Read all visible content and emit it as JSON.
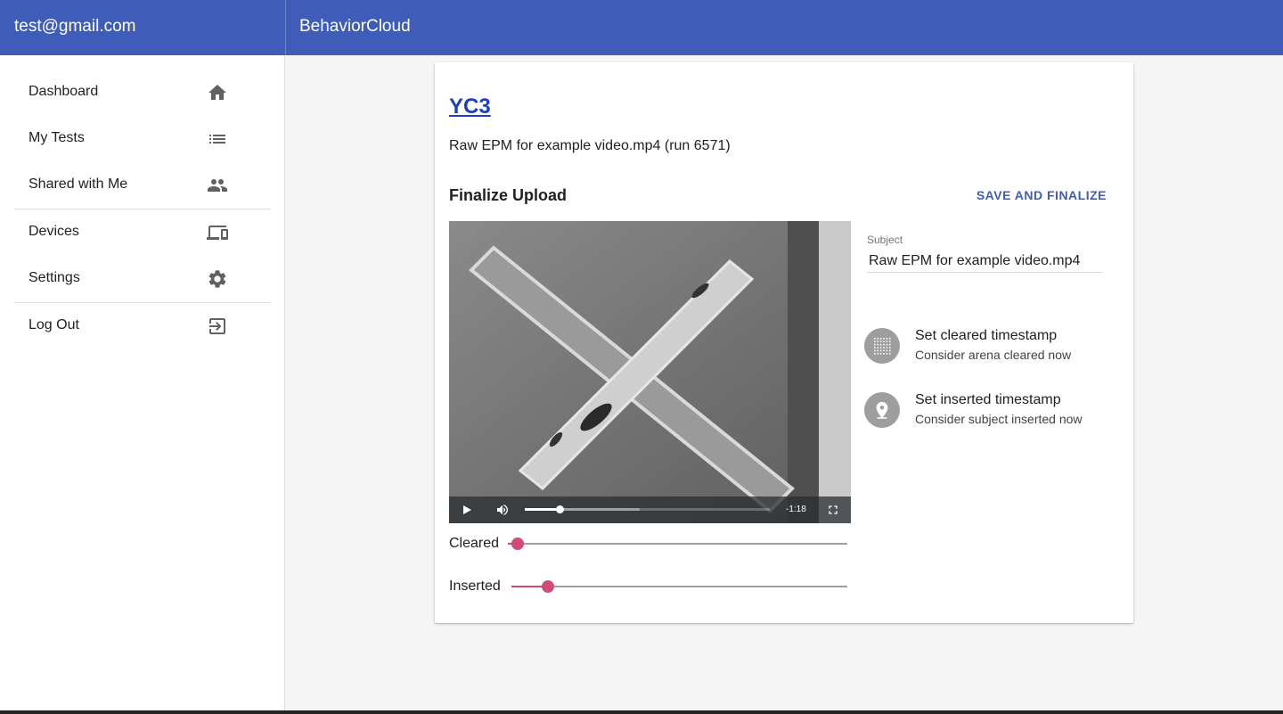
{
  "appbar": {
    "user_email": "test@gmail.com",
    "app_title": "BehaviorCloud"
  },
  "sidebar": {
    "items": [
      {
        "label": "Dashboard",
        "icon": "home-icon"
      },
      {
        "label": "My Tests",
        "icon": "list-icon"
      },
      {
        "label": "Shared with Me",
        "icon": "people-icon"
      },
      {
        "label": "Devices",
        "icon": "devices-icon"
      },
      {
        "label": "Settings",
        "icon": "gear-icon"
      },
      {
        "label": "Log Out",
        "icon": "exit-icon"
      }
    ]
  },
  "card": {
    "title": "YC3",
    "subtitle": "Raw EPM for example video.mp4 (run 6571)",
    "section_title": "Finalize Upload",
    "save_label": "SAVE AND FINALIZE"
  },
  "video": {
    "time_remaining": "-1:18",
    "played_fraction": 0.14,
    "buffered_fraction": 0.47
  },
  "sliders": [
    {
      "label": "Cleared",
      "value_fraction": 0.03
    },
    {
      "label": "Inserted",
      "value_fraction": 0.11
    }
  ],
  "subject": {
    "label": "Subject",
    "value": "Raw EPM for example video.mp4"
  },
  "actions": [
    {
      "primary": "Set cleared timestamp",
      "secondary": "Consider arena cleared now",
      "icon": "grid-dots-icon"
    },
    {
      "primary": "Set inserted timestamp",
      "secondary": "Consider subject inserted now",
      "icon": "location-pin-icon"
    }
  ],
  "colors": {
    "primary": "#3f5db8",
    "accent": "#d14b78",
    "link": "#1a3fbf"
  }
}
